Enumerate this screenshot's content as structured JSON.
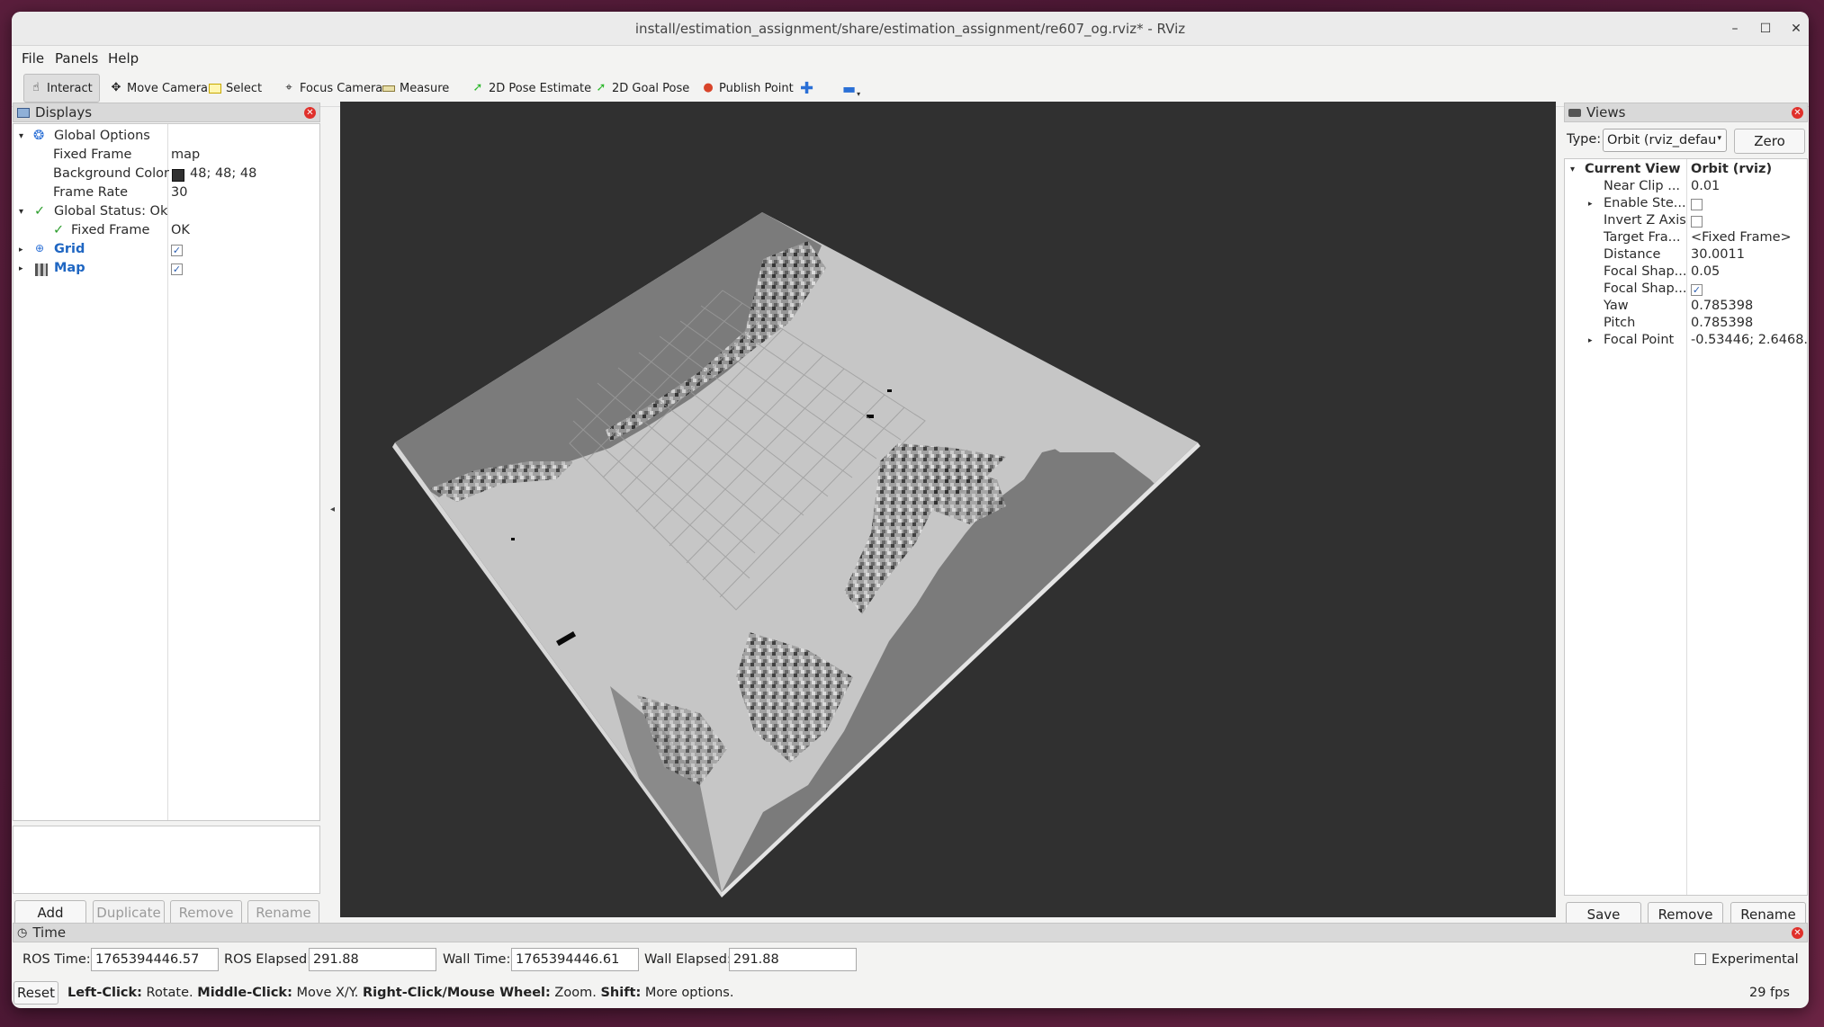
{
  "window": {
    "title": "install/estimation_assignment/share/estimation_assignment/re607_og.rviz* - RViz"
  },
  "menu": [
    "File",
    "Panels",
    "Help"
  ],
  "toolbar": {
    "interact": "Interact",
    "move_camera": "Move Camera",
    "select": "Select",
    "focus_camera": "Focus Camera",
    "measure": "Measure",
    "pose_estimate": "2D Pose Estimate",
    "goal_pose": "2D Goal Pose",
    "publish_point": "Publish Point"
  },
  "displays": {
    "title": "Displays",
    "global_options": "Global Options",
    "fixed_frame_label": "Fixed Frame",
    "fixed_frame_value": "map",
    "bg_color_label": "Background Color",
    "bg_color_value": "48; 48; 48",
    "frame_rate_label": "Frame Rate",
    "frame_rate_value": "30",
    "global_status": "Global Status: Ok",
    "status_fixed_frame": "Fixed Frame",
    "status_fixed_frame_value": "OK",
    "grid": "Grid",
    "map": "Map",
    "buttons": {
      "add": "Add",
      "duplicate": "Duplicate",
      "remove": "Remove",
      "rename": "Rename"
    }
  },
  "views": {
    "title": "Views",
    "type_label": "Type:",
    "type_value": "Orbit (rviz_defau",
    "zero": "Zero",
    "current_view": "Current View",
    "current_view_value": "Orbit (rviz)",
    "props": [
      {
        "name": "Near Clip ...",
        "value": "0.01"
      },
      {
        "name": "Enable Ste...",
        "value": ""
      },
      {
        "name": "Invert Z Axis",
        "value": ""
      },
      {
        "name": "Target Fra...",
        "value": "<Fixed Frame>"
      },
      {
        "name": "Distance",
        "value": "30.0011"
      },
      {
        "name": "Focal Shap...",
        "value": "0.05"
      },
      {
        "name": "Focal Shap...",
        "value": ""
      },
      {
        "name": "Yaw",
        "value": "0.785398"
      },
      {
        "name": "Pitch",
        "value": "0.785398"
      },
      {
        "name": "Focal Point",
        "value": "-0.53446; 2.6468..."
      }
    ],
    "buttons": {
      "save": "Save",
      "remove": "Remove",
      "rename": "Rename"
    }
  },
  "time": {
    "title": "Time",
    "ros_time_label": "ROS Time:",
    "ros_time": "1765394446.57",
    "ros_elapsed_label": "ROS Elapsed:",
    "ros_elapsed": "291.88",
    "wall_time_label": "Wall Time:",
    "wall_time": "1765394446.61",
    "wall_elapsed_label": "Wall Elapsed:",
    "wall_elapsed": "291.88",
    "experimental": "Experimental"
  },
  "status": {
    "reset": "Reset",
    "left_click": "Left-Click:",
    "left_click_desc": " Rotate. ",
    "middle_click": "Middle-Click:",
    "middle_click_desc": " Move X/Y. ",
    "right_click": "Right-Click/Mouse Wheel:",
    "right_click_desc": " Zoom. ",
    "shift": "Shift:",
    "shift_desc": " More options.",
    "fps": "29 fps"
  },
  "colors": {
    "viewport_bg": "#303030",
    "map_free": "#c6c6c6",
    "map_unknown": "#7b7b7b",
    "map_occupied": "#0a0a0a",
    "status_ok": "#2e9e2e",
    "link_blue": "#1f66c2"
  }
}
